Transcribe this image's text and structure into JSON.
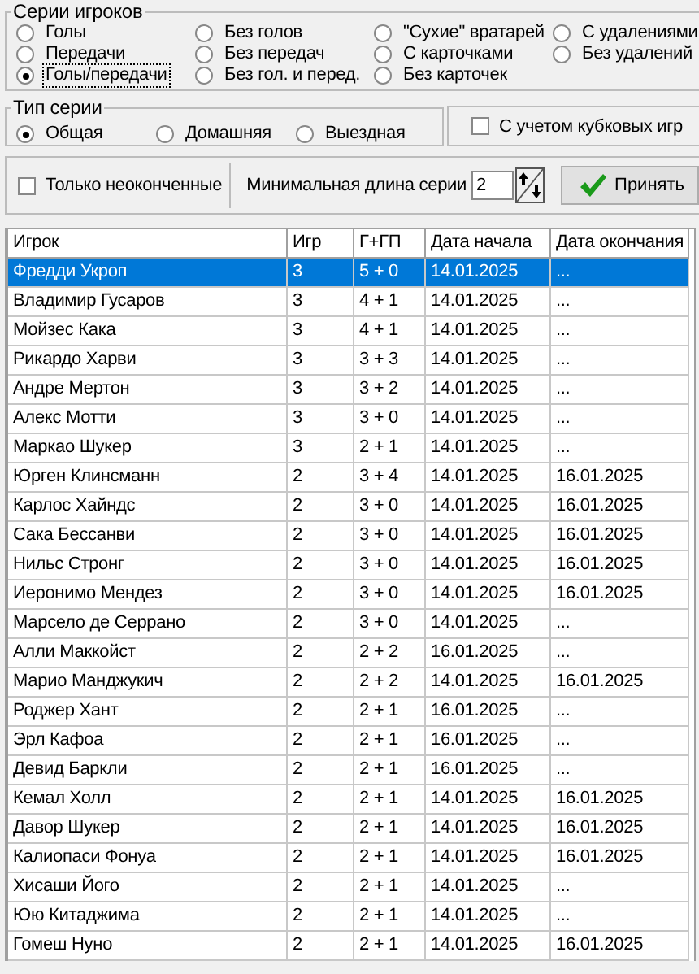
{
  "series_group": {
    "title": "Серии игроков",
    "options": [
      {
        "label": "Голы",
        "selected": false,
        "focused": false
      },
      {
        "label": "Передачи",
        "selected": false,
        "focused": false
      },
      {
        "label": "Голы/передачи",
        "selected": true,
        "focused": true
      },
      {
        "label": "Без голов",
        "selected": false,
        "focused": false
      },
      {
        "label": "Без передач",
        "selected": false,
        "focused": false
      },
      {
        "label": "Без гол. и перед.",
        "selected": false,
        "focused": false
      },
      {
        "label": "\"Сухие\" вратарей",
        "selected": false,
        "focused": false
      },
      {
        "label": "С карточками",
        "selected": false,
        "focused": false
      },
      {
        "label": "Без карточек",
        "selected": false,
        "focused": false
      },
      {
        "label": "С удалениями",
        "selected": false,
        "focused": false
      },
      {
        "label": "Без удалений",
        "selected": false,
        "focused": false
      }
    ]
  },
  "type_group": {
    "title": "Тип серии",
    "options": [
      {
        "label": "Общая",
        "selected": true
      },
      {
        "label": "Домашняя",
        "selected": false
      },
      {
        "label": "Выездная",
        "selected": false
      }
    ]
  },
  "cup_games": {
    "label": "С учетом кубковых игр",
    "checked": false
  },
  "unfinished_only": {
    "label": "Только неоконченные",
    "checked": false
  },
  "min_length": {
    "label": "Минимальная длина серии",
    "value": "2"
  },
  "apply_button": "Принять",
  "table": {
    "columns": [
      "Игрок",
      "Игр",
      "Г+ГП",
      "Дата начала",
      "Дата окончания"
    ],
    "rows": [
      {
        "cells": [
          "Фредди Укроп",
          "3",
          "5 + 0",
          "14.01.2025",
          "..."
        ],
        "selected": true
      },
      {
        "cells": [
          "Владимир Гусаров",
          "3",
          "4 + 1",
          "14.01.2025",
          "..."
        ],
        "selected": false
      },
      {
        "cells": [
          "Мойзес Кака",
          "3",
          "4 + 1",
          "14.01.2025",
          "..."
        ],
        "selected": false
      },
      {
        "cells": [
          "Рикардо Харви",
          "3",
          "3 + 3",
          "14.01.2025",
          "..."
        ],
        "selected": false
      },
      {
        "cells": [
          "Андре Мертон",
          "3",
          "3 + 2",
          "14.01.2025",
          "..."
        ],
        "selected": false
      },
      {
        "cells": [
          "Алекс Мотти",
          "3",
          "3 + 0",
          "14.01.2025",
          "..."
        ],
        "selected": false
      },
      {
        "cells": [
          "Маркао Шукер",
          "3",
          "2 + 1",
          "14.01.2025",
          "..."
        ],
        "selected": false
      },
      {
        "cells": [
          "Юрген Клинсманн",
          "2",
          "3 + 4",
          "14.01.2025",
          "16.01.2025"
        ],
        "selected": false
      },
      {
        "cells": [
          "Карлос Хайндс",
          "2",
          "3 + 0",
          "14.01.2025",
          "16.01.2025"
        ],
        "selected": false
      },
      {
        "cells": [
          "Сака Бессанви",
          "2",
          "3 + 0",
          "14.01.2025",
          "16.01.2025"
        ],
        "selected": false
      },
      {
        "cells": [
          "Нильс Стронг",
          "2",
          "3 + 0",
          "14.01.2025",
          "16.01.2025"
        ],
        "selected": false
      },
      {
        "cells": [
          "Иеронимо Мендез",
          "2",
          "3 + 0",
          "14.01.2025",
          "16.01.2025"
        ],
        "selected": false
      },
      {
        "cells": [
          "Марсело де Серрано",
          "2",
          "3 + 0",
          "14.01.2025",
          "..."
        ],
        "selected": false
      },
      {
        "cells": [
          "Алли Маккойст",
          "2",
          "2 + 2",
          "16.01.2025",
          "..."
        ],
        "selected": false
      },
      {
        "cells": [
          "Марио Манджукич",
          "2",
          "2 + 2",
          "14.01.2025",
          "16.01.2025"
        ],
        "selected": false
      },
      {
        "cells": [
          "Роджер Хант",
          "2",
          "2 + 1",
          "16.01.2025",
          "..."
        ],
        "selected": false
      },
      {
        "cells": [
          "Эрл Кафоа",
          "2",
          "2 + 1",
          "16.01.2025",
          "..."
        ],
        "selected": false
      },
      {
        "cells": [
          "Девид Баркли",
          "2",
          "2 + 1",
          "16.01.2025",
          "..."
        ],
        "selected": false
      },
      {
        "cells": [
          "Кемал Холл",
          "2",
          "2 + 1",
          "14.01.2025",
          "16.01.2025"
        ],
        "selected": false
      },
      {
        "cells": [
          "Давор Шукер",
          "2",
          "2 + 1",
          "14.01.2025",
          "16.01.2025"
        ],
        "selected": false
      },
      {
        "cells": [
          "Калиопаси Фонуа",
          "2",
          "2 + 1",
          "14.01.2025",
          "16.01.2025"
        ],
        "selected": false
      },
      {
        "cells": [
          "Хисаши Його",
          "2",
          "2 + 1",
          "14.01.2025",
          "..."
        ],
        "selected": false
      },
      {
        "cells": [
          "Юю Китаджима",
          "2",
          "2 + 1",
          "14.01.2025",
          "..."
        ],
        "selected": false
      },
      {
        "cells": [
          "Гомеш Нуно",
          "2",
          "2 + 1",
          "14.01.2025",
          "16.01.2025"
        ],
        "selected": false
      }
    ]
  }
}
